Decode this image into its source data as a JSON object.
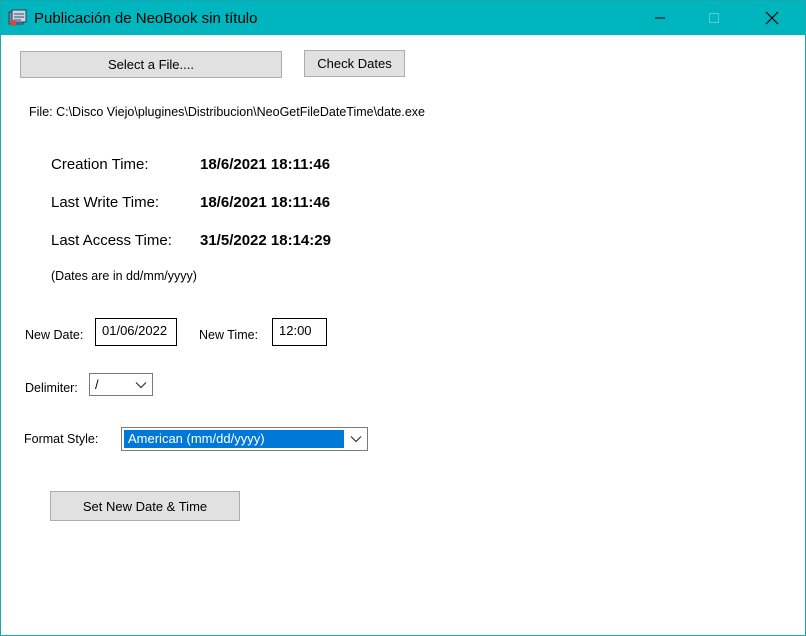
{
  "window": {
    "title": "Publicación de NeoBook sin título"
  },
  "toolbar": {
    "select_file_label": "Select a File....",
    "check_dates_label": "Check Dates"
  },
  "file": {
    "path_text": "File: C:\\Disco Viejo\\plugines\\Distribucion\\NeoGetFileDateTime\\date.exe"
  },
  "dates": {
    "creation_label": "Creation Time:",
    "creation_value": "18/6/2021 18:11:46",
    "last_write_label": "Last Write Time:",
    "last_write_value": "18/6/2021 18:11:46",
    "last_access_label": "Last Access Time:",
    "last_access_value": "31/5/2022 18:14:29",
    "format_note": "(Dates are in dd/mm/yyyy)"
  },
  "form": {
    "new_date_label": "New Date:",
    "new_date_value": "01/06/2022",
    "new_time_label": "New Time:",
    "new_time_value": "12:00",
    "delimiter_label": "Delimiter:",
    "delimiter_value": "/",
    "format_style_label": "Format Style:",
    "format_style_value": "American (mm/dd/yyyy)",
    "set_button_label": "Set New Date & Time"
  },
  "icons": {
    "app": "neobook-app-icon",
    "minimize": "minimize-icon",
    "maximize": "maximize-icon",
    "close": "close-icon",
    "dropdown": "chevron-down-icon"
  },
  "colors": {
    "titlebar": "#00b6be",
    "selection": "#0078d7",
    "button_face": "#e1e1e1"
  }
}
